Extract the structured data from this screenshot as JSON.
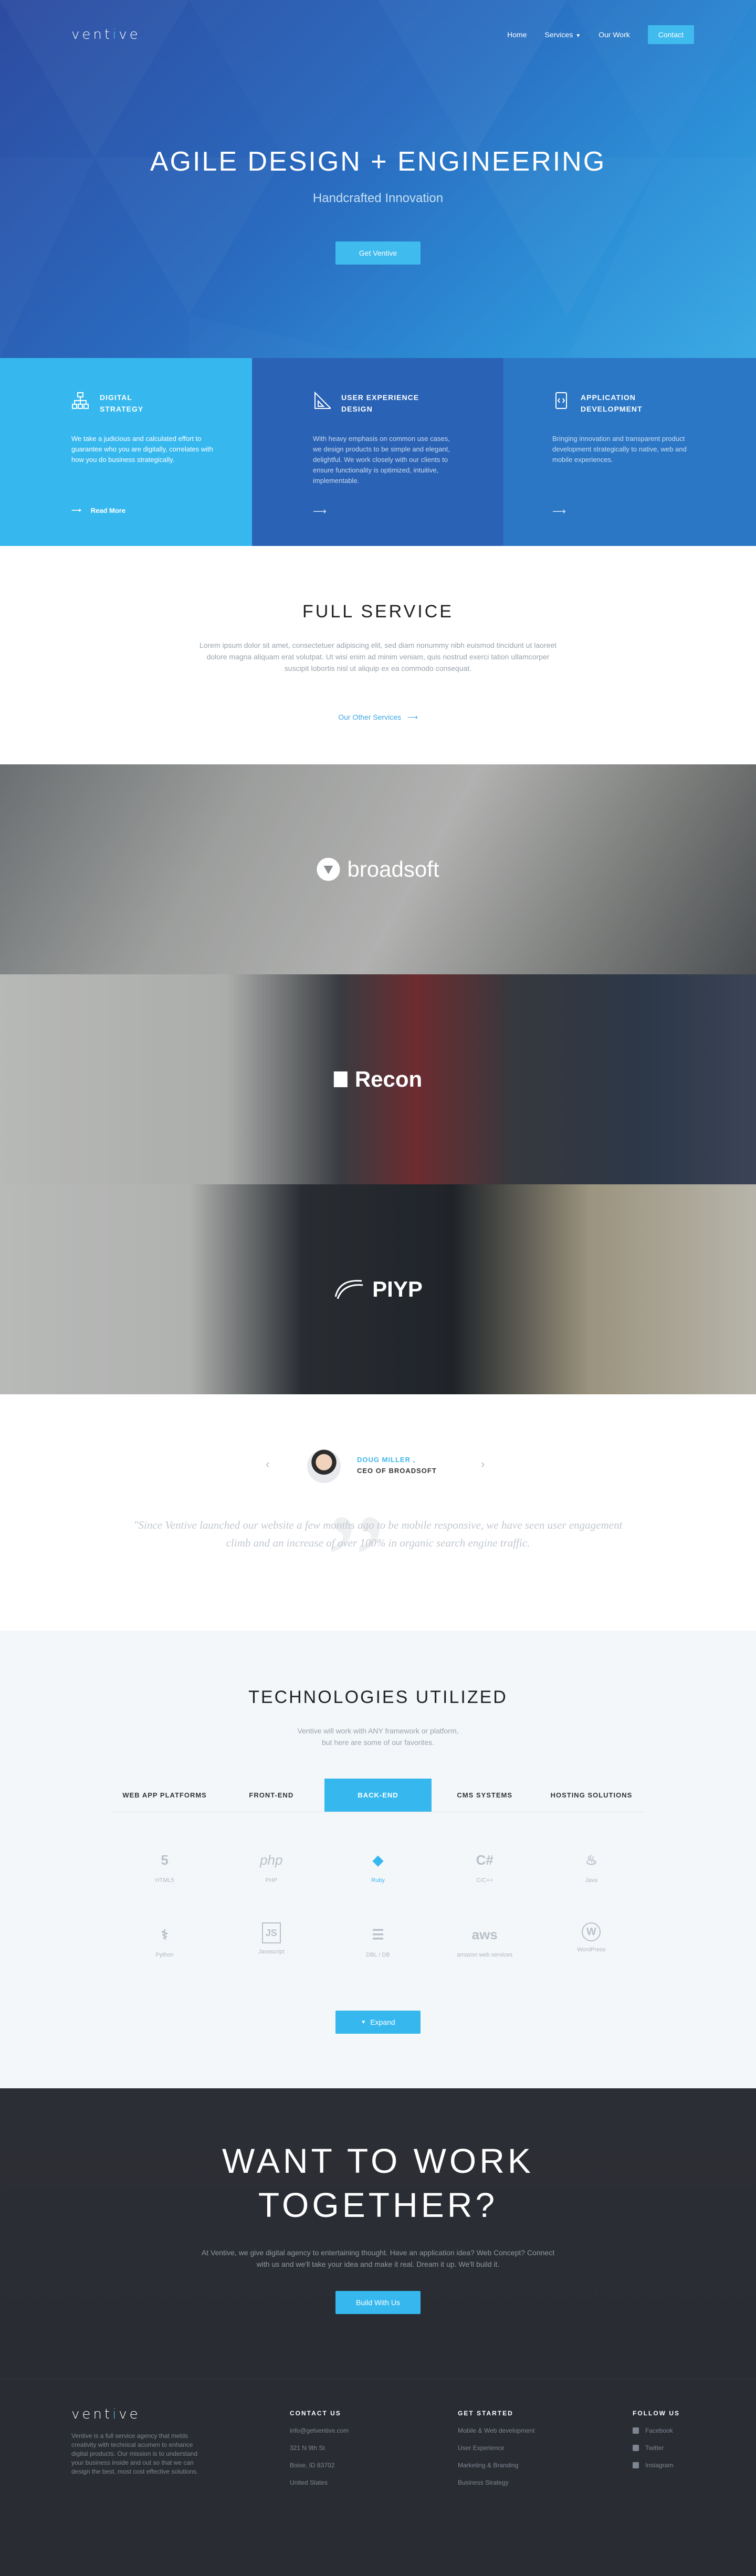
{
  "nav": {
    "logo_pre": "vent",
    "logo_mid": "i",
    "logo_post": "ve",
    "home": "Home",
    "services": "Services",
    "work": "Our Work",
    "contact": "Contact"
  },
  "hero": {
    "title": "AGILE DESIGN + ENGINEERING",
    "subtitle": "Handcrafted Innovation",
    "button": "Get Ventive"
  },
  "panels": [
    {
      "title1": "DIGITAL",
      "title2": "STRATEGY",
      "text": "We take a judicious and calculated effort to guarantee who you are digitally, correlates with how you do business strategically.",
      "link": "Read More"
    },
    {
      "title1": "USER EXPERIENCE",
      "title2": "DESIGN",
      "text": "With heavy emphasis on common use cases, we design products to be simple and elegant, delightful. We work closely with our clients to ensure functionality is optimized, intuitive, implementable."
    },
    {
      "title1": "APPLICATION",
      "title2": "DEVELOPMENT",
      "text": "Bringing innovation and transparent product development strategically to native, web and mobile experiences."
    }
  ],
  "full": {
    "title": "FULL SERVICE",
    "text": "Lorem ipsum dolor sit amet, consectetuer adipiscing elit, sed diam nonummy nibh euismod tincidunt ut laoreet dolore magna aliquam erat volutpat. Ut wisi enim ad minim veniam, quis nostrud exerci tation ullamcorper suscipit lobortis nisl ut aliquip ex ea commodo consequat.",
    "link": "Our Other Services"
  },
  "clients": [
    "broadsoft",
    "Recon",
    "PIYP"
  ],
  "testimonial": {
    "name": "DOUG MILLER ,",
    "role": "CEO OF BROADSOFT",
    "quote": "\"Since Ventive launched our website a few months ago to be mobile responsive, we have seen user engagement climb and an increase of over 100% in organic search engine traffic."
  },
  "tech": {
    "title": "TECHNOLOGIES UTILIZED",
    "intro1": "Ventive will work with ANY framework or platform,",
    "intro2": "but here are some of our favorites.",
    "tabs": [
      "WEB APP PLATFORMS",
      "FRONT-END",
      "BACK-END",
      "CMS SYSTEMS",
      "HOSTING SOLUTIONS"
    ],
    "items": [
      {
        "icon": "5",
        "label": "HTML5"
      },
      {
        "icon": "php",
        "label": "PHP"
      },
      {
        "icon": "◆",
        "label": "Ruby"
      },
      {
        "icon": "C#",
        "label": "C/C++"
      },
      {
        "icon": "♨",
        "label": "Java"
      },
      {
        "icon": "⚕",
        "label": "Python"
      },
      {
        "icon": "JS",
        "label": "Javascript"
      },
      {
        "icon": "☰",
        "label": "DBL / DB"
      },
      {
        "icon": "aws",
        "label": "amazon web services"
      },
      {
        "icon": "W",
        "label": "WordPress"
      }
    ],
    "expand": "Expand"
  },
  "cta": {
    "line1": "WANT TO WORK",
    "line2": "TOGETHER?",
    "text": "At Ventive, we give digital agency to entertaining thought. Have an application idea? Web Concept? Connect with us and we'll take your idea and make it real. Dream it up. We'll build it.",
    "button": "Build With Us"
  },
  "footer": {
    "about": "Ventive is a full service agency that melds creativity with technical acumen to enhance digital products. Our mission is to understand your business inside and out so that we can design the best, most cost effective solutions.",
    "contact_h": "CONTACT US",
    "contact": [
      "info@getventive.com",
      "321 N 9th St",
      "Boise, ID 83702",
      "United States"
    ],
    "started_h": "GET STARTED",
    "started": [
      "Mobile & Web development",
      "User Experience",
      "Marketing & Branding",
      "Business Strategy"
    ],
    "follow_h": "FOLLOW US",
    "follow": [
      "Facebook",
      "Twitter",
      "Instagram"
    ]
  },
  "colors": {
    "accent": "#36b8ef",
    "dark": "#2a2c33",
    "hero_start": "#2d4ba0",
    "hero_end": "#37a8e3"
  }
}
